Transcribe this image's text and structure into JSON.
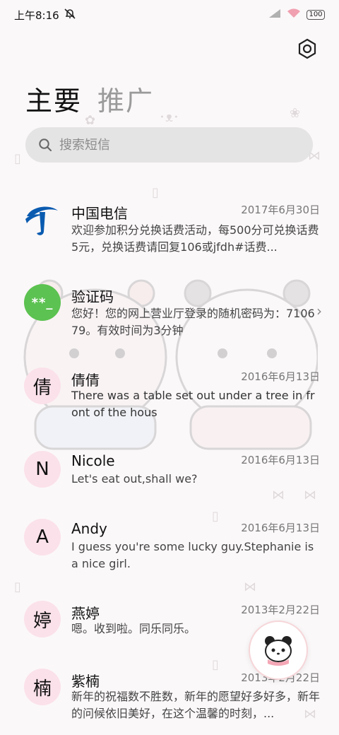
{
  "status_bar": {
    "time": "上午8:16",
    "battery": "100"
  },
  "header": {
    "tabs": [
      {
        "label": "主要",
        "active": true
      },
      {
        "label": "推广",
        "active": false
      }
    ]
  },
  "search": {
    "placeholder": "搜索短信"
  },
  "conversations": [
    {
      "avatar": "",
      "avatar_type": "telecom-logo",
      "name": "中国电信",
      "date": "2017年6月30日",
      "preview": "欢迎参加积分兑换话费活动，每500分可兑换话费5元，兑换话费请回复106或jfdh#话费..."
    },
    {
      "avatar": "**_",
      "avatar_type": "green",
      "name": "验证码",
      "date": "",
      "preview": "您好！您的网上营业厅登录的随机密码为：710679。有效时间为3分钟"
    },
    {
      "avatar": "倩",
      "avatar_type": "letter",
      "name": "倩倩",
      "date": "2016年6月13日",
      "preview": "There was a table set out under a tree in front of the hous"
    },
    {
      "avatar": "N",
      "avatar_type": "letter",
      "name": "Nicole",
      "date": "2016年6月13日",
      "preview": "Let's eat out,shall we?"
    },
    {
      "avatar": "A",
      "avatar_type": "letter",
      "name": "Andy",
      "date": "2016年6月13日",
      "preview": "I guess you're some lucky guy.Stephanie is a nice girl."
    },
    {
      "avatar": "婷",
      "avatar_type": "letter",
      "name": "燕婷",
      "date": "2013年2月22日",
      "preview": "嗯。收到啦。同乐同乐。"
    },
    {
      "avatar": "楠",
      "avatar_type": "letter",
      "name": "紫楠",
      "date": "2013年2月22日",
      "preview": "新年的祝福数不胜数，新年的愿望好多好多，新年的问候依旧美好，在这个温馨的时刻，..."
    }
  ],
  "colors": {
    "avatar_bg": "#fbe1ea",
    "verify_green": "#5cc251",
    "telecom_blue": "#0a5bb0"
  }
}
